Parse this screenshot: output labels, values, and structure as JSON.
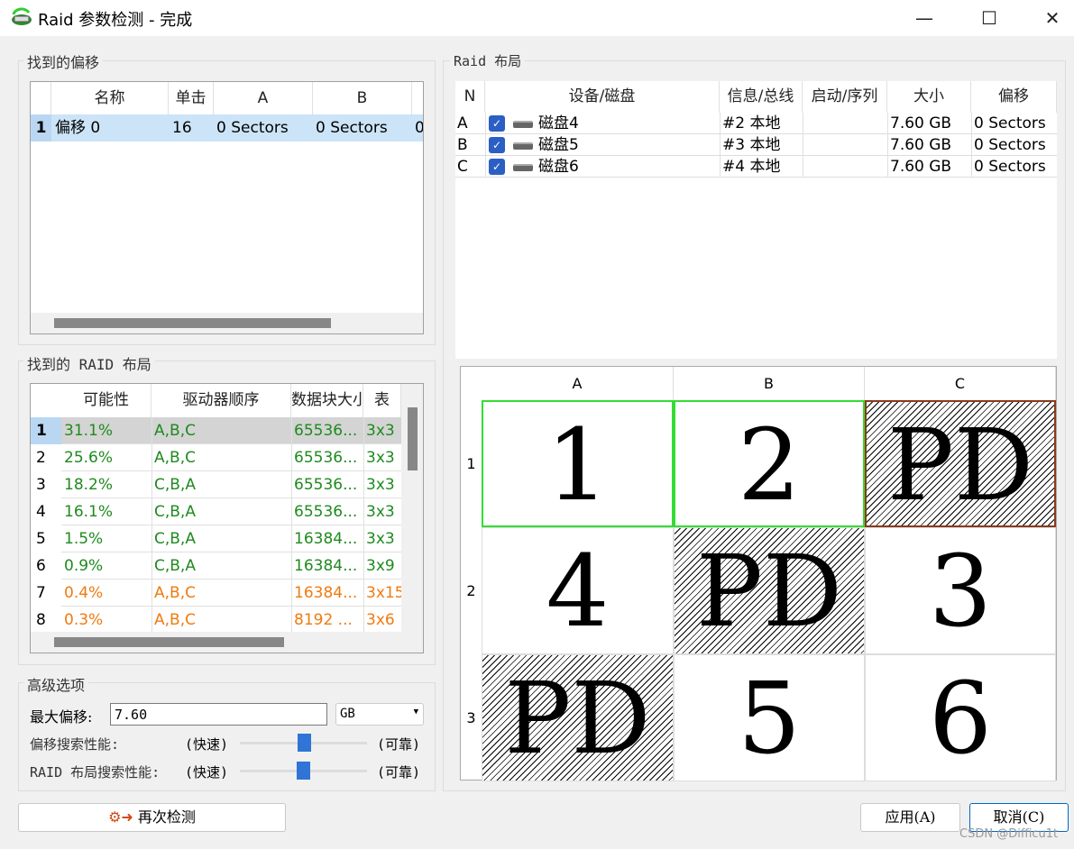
{
  "window": {
    "title": "Raid 参数检测 - 完成",
    "minimize": "—",
    "maximize": "☐",
    "close": "✕"
  },
  "offsets": {
    "group_label": "找到的偏移",
    "columns": [
      "名称",
      "单击",
      "A",
      "B"
    ],
    "rows": [
      {
        "num": "1",
        "name": "偏移 0",
        "clicks": "16",
        "a": "0 Sectors",
        "b": "0 Sectors",
        "more": "0"
      }
    ]
  },
  "layouts": {
    "group_label": "找到的 RAID 布局",
    "columns": [
      "可能性",
      "驱动器顺序",
      "数据块大小",
      "表"
    ],
    "rows": [
      {
        "num": "1",
        "prob": "31.1%",
        "order": "A,B,C",
        "block": "65536...",
        "table": "3x3",
        "level": "green"
      },
      {
        "num": "2",
        "prob": "25.6%",
        "order": "A,B,C",
        "block": "65536...",
        "table": "3x3",
        "level": "green"
      },
      {
        "num": "3",
        "prob": "18.2%",
        "order": "C,B,A",
        "block": "65536...",
        "table": "3x3",
        "level": "green"
      },
      {
        "num": "4",
        "prob": "16.1%",
        "order": "C,B,A",
        "block": "65536...",
        "table": "3x3",
        "level": "green"
      },
      {
        "num": "5",
        "prob": "1.5%",
        "order": "C,B,A",
        "block": "16384...",
        "table": "3x3",
        "level": "green"
      },
      {
        "num": "6",
        "prob": "0.9%",
        "order": "C,B,A",
        "block": "16384...",
        "table": "3x9",
        "level": "green"
      },
      {
        "num": "7",
        "prob": "0.4%",
        "order": "A,B,C",
        "block": "16384...",
        "table": "3x15",
        "level": "orange"
      },
      {
        "num": "8",
        "prob": "0.3%",
        "order": "A,B,C",
        "block": "8192 ...",
        "table": "3x6",
        "level": "orange"
      }
    ]
  },
  "advanced": {
    "group_label": "高级选项",
    "max_offset_label": "最大偏移:",
    "max_offset_value": "7.60",
    "unit": "GB",
    "offset_perf_label": "偏移搜索性能:",
    "raid_perf_label": "RAID 布局搜索性能:",
    "fast": "(快速)",
    "reliable": "(可靠)",
    "offset_perf_value": 0.5,
    "raid_perf_value": 0.5
  },
  "redetect_label": "再次检测",
  "raid_layout": {
    "group_label": "Raid 布局",
    "columns": [
      "N",
      "设备/磁盘",
      "信息/总线",
      "启动/序列",
      "大小",
      "偏移"
    ],
    "disks": [
      {
        "n": "A",
        "name": "磁盘4",
        "bus": "#2 本地",
        "boot": "",
        "size": "7.60 GB",
        "offset": "0 Sectors",
        "checked": true
      },
      {
        "n": "B",
        "name": "磁盘5",
        "bus": "#3 本地",
        "boot": "",
        "size": "7.60 GB",
        "offset": "0 Sectors",
        "checked": true
      },
      {
        "n": "C",
        "name": "磁盘6",
        "bus": "#4 本地",
        "boot": "",
        "size": "7.60 GB",
        "offset": "0 Sectors",
        "checked": true
      }
    ],
    "grid_cols": [
      "A",
      "B",
      "C"
    ],
    "grid_rows": [
      "1",
      "2",
      "3"
    ],
    "grid": [
      [
        "1",
        "2",
        "PD"
      ],
      [
        "4",
        "PD",
        "3"
      ],
      [
        "PD",
        "5",
        "6"
      ]
    ],
    "colors": {
      "data_highlight": "#33dd33",
      "parity_highlight": "#8b3a1a"
    }
  },
  "apply_label": "应用(A)",
  "cancel_label": "取消(C)",
  "watermark": "CSDN @Difficu1t"
}
